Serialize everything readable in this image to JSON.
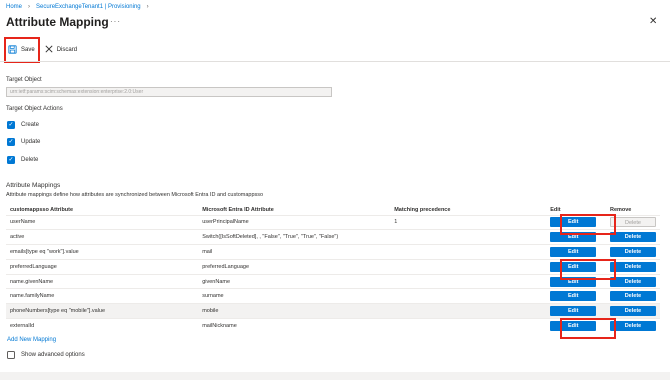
{
  "breadcrumb": {
    "home": "Home",
    "tenant": "SecureExchangeTenant1 | Provisioning"
  },
  "page": {
    "title": "Attribute Mapping",
    "more": "···",
    "close": "✕"
  },
  "toolbar": {
    "save_label": "Save",
    "discard_label": "Discard"
  },
  "target_object": {
    "label": "Target Object",
    "value": "urn:ietf:params:scim:schemas:extension:enterprise:2.0:User"
  },
  "target_actions": {
    "label": "Target Object Actions",
    "items": [
      {
        "label": "Create",
        "checked": true
      },
      {
        "label": "Update",
        "checked": true
      },
      {
        "label": "Delete",
        "checked": true
      }
    ]
  },
  "mappings": {
    "heading": "Attribute Mappings",
    "description": "Attribute mappings define how attributes are synchronized between Microsoft Entra ID and customappsso",
    "columns": [
      "customappsso Attribute",
      "Microsoft Entra ID Attribute",
      "Matching precedence",
      "Edit",
      "Remove"
    ],
    "edit_label": "Edit",
    "delete_label": "Delete",
    "rows": [
      {
        "target": "userName",
        "source": "userPrincipalName",
        "precedence": "1"
      },
      {
        "target": "active",
        "source": "Switch([IsSoftDeleted], , \"False\", \"True\", \"True\", \"False\")",
        "precedence": ""
      },
      {
        "target": "emails[type eq \"work\"].value",
        "source": "mail",
        "precedence": ""
      },
      {
        "target": "preferredLanguage",
        "source": "preferredLanguage",
        "precedence": ""
      },
      {
        "target": "name.givenName",
        "source": "givenName",
        "precedence": ""
      },
      {
        "target": "name.familyName",
        "source": "surname",
        "precedence": ""
      },
      {
        "target": "phoneNumbers[type eq \"mobile\"].value",
        "source": "mobile",
        "precedence": ""
      },
      {
        "target": "externalId",
        "source": "mailNickname",
        "precedence": ""
      }
    ],
    "add_link": "Add New Mapping"
  },
  "advanced": {
    "label": "Show advanced options",
    "checked": false
  },
  "colors": {
    "accent": "#0078d4",
    "highlight": "#e6251a"
  }
}
